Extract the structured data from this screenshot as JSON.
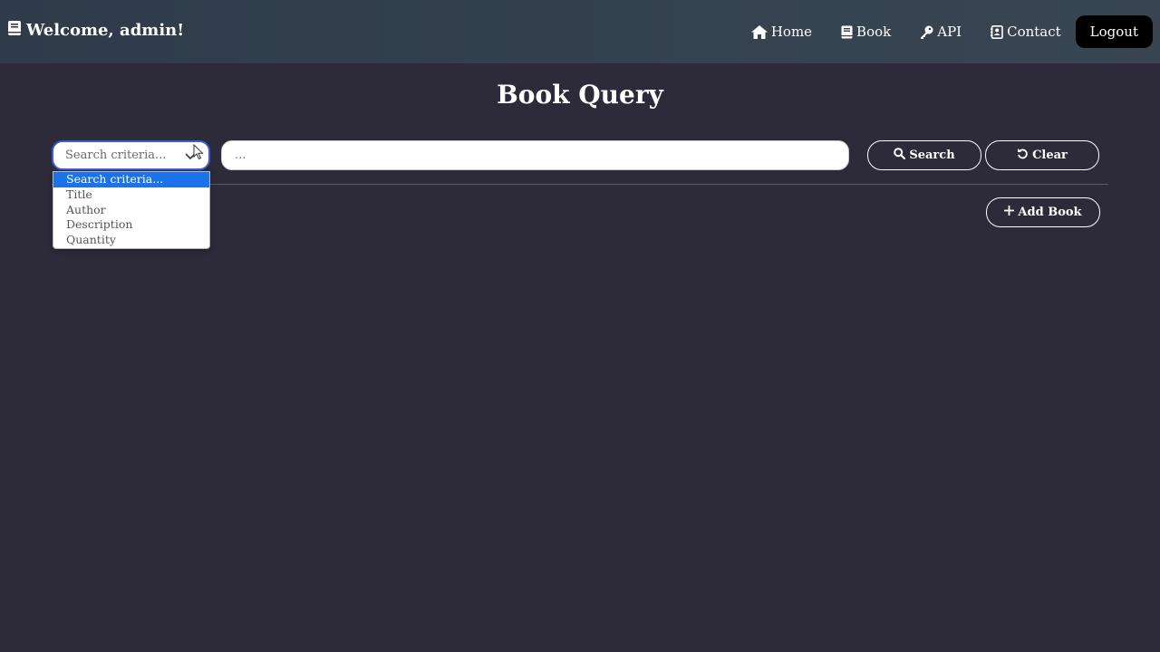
{
  "navbar": {
    "brand_icon": "book-icon",
    "brand_text": "Welcome, admin!",
    "links": [
      {
        "label": "Home",
        "icon": "home-icon"
      },
      {
        "label": "Book",
        "icon": "book-icon"
      },
      {
        "label": "API",
        "icon": "key-icon"
      },
      {
        "label": "Contact",
        "icon": "contact-card-icon"
      }
    ],
    "logout_label": "Logout"
  },
  "main": {
    "title": "Book Query",
    "criteria_select": {
      "selected": "Search criteria...",
      "options": [
        "Search criteria...",
        "Title",
        "Author",
        "Description",
        "Quantity"
      ]
    },
    "search_input": {
      "placeholder": "...",
      "value": ""
    },
    "search_label": "Search",
    "clear_label": "Clear",
    "add_label": "Add Book"
  },
  "colors": {
    "background": "#2d2b3a",
    "navbar": "#394652",
    "accent": "#1a73e8",
    "logout_bg": "#000000"
  }
}
